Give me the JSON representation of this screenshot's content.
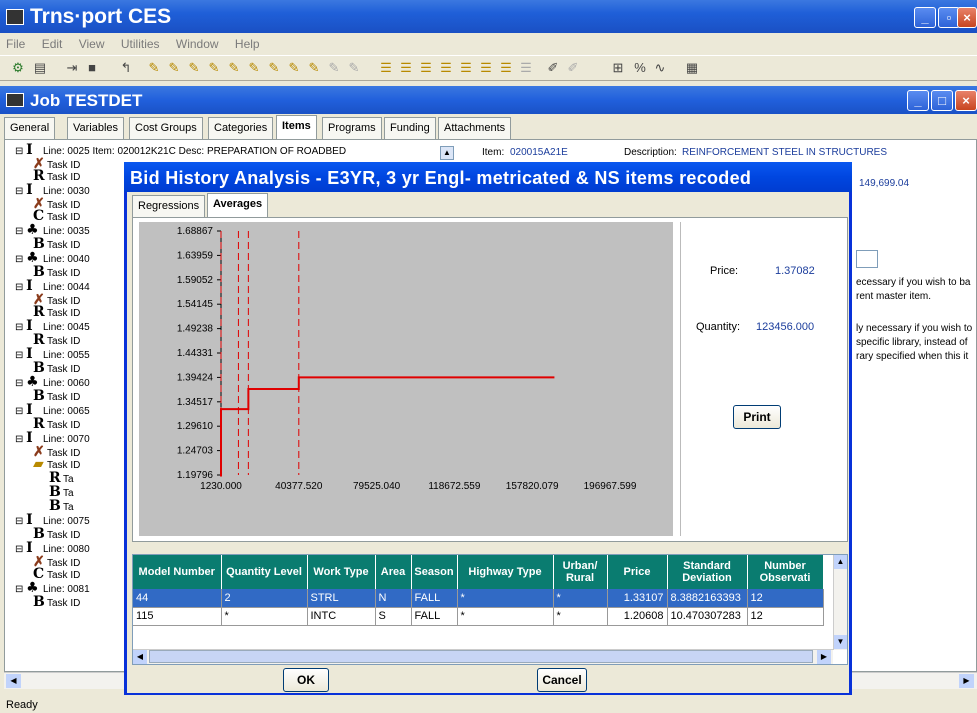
{
  "app": {
    "title": "Trns·port CES"
  },
  "menu": [
    "File",
    "Edit",
    "View",
    "Utilities",
    "Window",
    "Help"
  ],
  "job": {
    "title": "Job TESTDET",
    "tabs": [
      "General",
      "Variables",
      "Cost Groups",
      "Categories",
      "Items",
      "Programs",
      "Funding",
      "Attachments"
    ],
    "active_tab": "Items"
  },
  "tree": {
    "lines": [
      {
        "label": "Line: 0025 Item: 020012K21C  Desc: PREPARATION OF ROADBED"
      },
      {
        "label": "Line: 0030"
      },
      {
        "label": "Line: 0035"
      },
      {
        "label": "Line: 0040"
      },
      {
        "label": "Line: 0044"
      },
      {
        "label": "Line: 0045"
      },
      {
        "label": "Line: 0055"
      },
      {
        "label": "Line: 0060"
      },
      {
        "label": "Line: 0065"
      },
      {
        "label": "Line: 0070"
      },
      {
        "label": "Line: 0075"
      },
      {
        "label": "Line: 0080"
      },
      {
        "label": "Line: 0081"
      }
    ],
    "task_label": "Task ID",
    "sub_label": "Ta"
  },
  "right_pane": {
    "item_label": "Item:",
    "item_value": "020015A21E",
    "desc_label": "Description:",
    "desc_value": "REINFORCEMENT STEEL IN STRUCTURES",
    "amount": "149,699.04",
    "note1_a": "ecessary if you wish to ba",
    "note1_b": "rent master item.",
    "note2_a": "ly necessary if you wish to",
    "note2_b": " specific library, instead of",
    "note2_c": "rary specified when this it"
  },
  "dialog": {
    "title": "Bid History Analysis - E3YR, 3 yr Engl- metricated & NS items recoded",
    "tabs": [
      "Regressions",
      "Averages"
    ],
    "active_tab": "Averages",
    "price_label": "Price:",
    "price_value": "1.37082",
    "quantity_label": "Quantity:",
    "quantity_value": "123456.000",
    "print_label": "Print",
    "ok_label": "OK",
    "cancel_label": "Cancel"
  },
  "chart_data": {
    "type": "line",
    "title": "",
    "xlabel": "",
    "ylabel": "",
    "x_ticks": [
      "1230.000",
      "40377.520",
      "79525.040",
      "118672.559",
      "157820.079",
      "196967.599"
    ],
    "x_tick_values": [
      1230.0,
      40377.52,
      79525.04,
      118672.559,
      157820.079,
      196967.599
    ],
    "y_ticks": [
      "1.68867",
      "1.63959",
      "1.59052",
      "1.54145",
      "1.49238",
      "1.44331",
      "1.39424",
      "1.34517",
      "1.29610",
      "1.24703",
      "1.19796"
    ],
    "y_tick_values": [
      1.68867,
      1.63959,
      1.59052,
      1.54145,
      1.49238,
      1.44331,
      1.39424,
      1.34517,
      1.2961,
      1.24703,
      1.19796
    ],
    "xlim": [
      1230.0,
      196967.599
    ],
    "ylim": [
      1.19796,
      1.68867
    ],
    "series": [
      {
        "color": "#e00000",
        "x": [
          1230,
          1230,
          15000,
          15000,
          40377.52,
          40377.52,
          169000
        ],
        "y": [
          1.195,
          1.3305,
          1.3305,
          1.37082,
          1.37082,
          1.39424,
          1.39424
        ]
      }
    ],
    "dashed_x": [
      1230,
      10000,
      15000,
      40377.52
    ],
    "grid": false
  },
  "grid": {
    "columns": [
      "Model Number",
      "Quantity Level",
      "Work Type",
      "Area",
      "Season",
      "Highway Type",
      "Urban/ Rural",
      "Price",
      "Standard Deviation",
      "Number Observati"
    ],
    "rows": [
      [
        "44",
        "2",
        "STRL",
        "N",
        "FALL",
        "*",
        "*",
        "1.33107",
        "8.3882163393",
        "12"
      ],
      [
        "115",
        "*",
        "INTC",
        "S",
        "FALL",
        "*",
        "*",
        "1.20608",
        "10.470307283",
        "12"
      ]
    ]
  },
  "status": {
    "text": "Ready"
  },
  "colors": {
    "titlebar": "#1f5fd8",
    "grid_header": "#0a7c70",
    "selection": "#316ac5",
    "series": "#e00000"
  }
}
